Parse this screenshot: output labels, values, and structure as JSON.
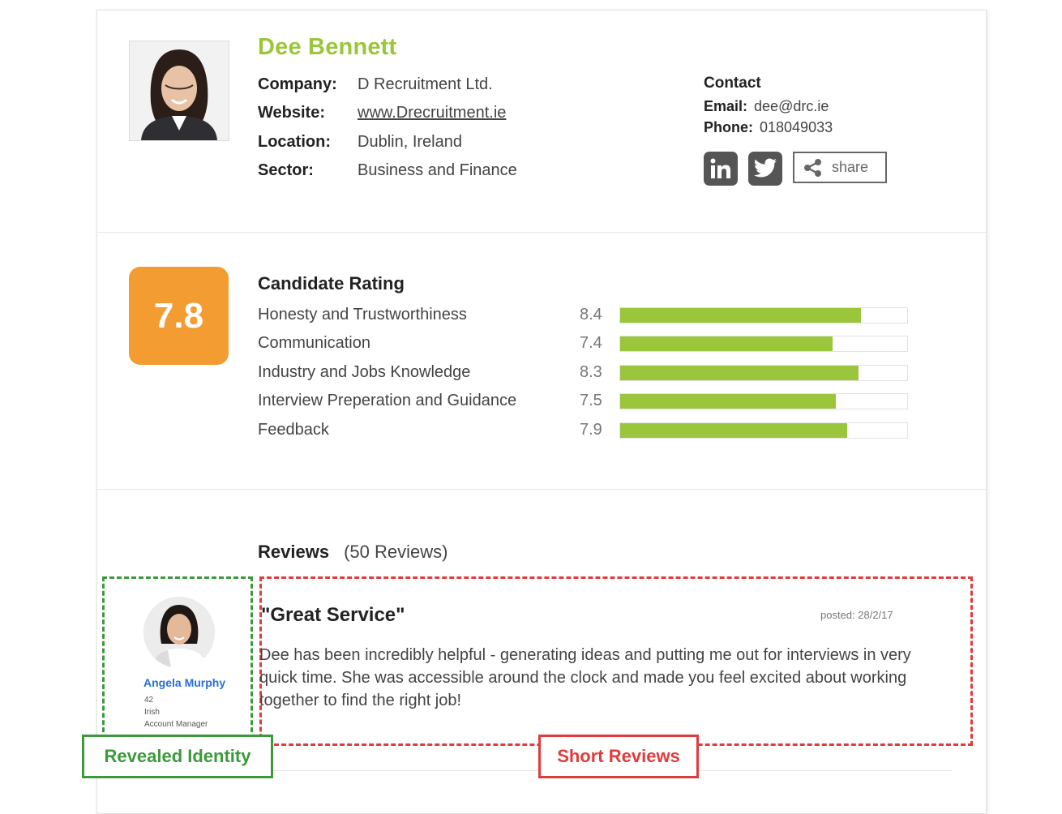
{
  "profile": {
    "name": "Dee Bennett",
    "fields": [
      {
        "label": "Company:",
        "value": "D Recruitment Ltd."
      },
      {
        "label": "Website:",
        "value": "www.Drecruitment.ie"
      },
      {
        "label": "Location:",
        "value": "Dublin, Ireland"
      },
      {
        "label": "Sector:",
        "value": "Business and Finance"
      }
    ]
  },
  "contact": {
    "title": "Contact",
    "email_label": "Email:",
    "email": "dee@drc.ie",
    "phone_label": "Phone:",
    "phone": "018049033",
    "share_label": "share"
  },
  "rating": {
    "overall": "7.8",
    "title": "Candidate Rating",
    "max": 10,
    "items": [
      {
        "label": "Honesty and Trustworthiness",
        "value": "8.4",
        "score": 8.4
      },
      {
        "label": "Communication",
        "value": "7.4",
        "score": 7.4
      },
      {
        "label": "Industry and Jobs Knowledge",
        "value": "8.3",
        "score": 8.3
      },
      {
        "label": "Interview Preperation and Guidance",
        "value": "7.5",
        "score": 7.5
      },
      {
        "label": "Feedback",
        "value": "7.9",
        "score": 7.9
      }
    ],
    "bar_color": "#9bc63b",
    "badge_color": "#f39c32"
  },
  "reviews": {
    "title": "Reviews",
    "count": "(50 Reviews)",
    "items": [
      {
        "reviewer_name": "Angela Murphy",
        "reviewer_age": "42",
        "reviewer_nationality": "Irish",
        "reviewer_role": "Account Manager",
        "title": "\"Great Service\"",
        "posted": "posted: 28/2/17",
        "body": "Dee has been incredibly helpful - generating ideas and putting me out for interviews in very quick time. She was accessible around the clock and made you feel excited about working together to find the right job!"
      }
    ]
  },
  "annotations": {
    "revealed_identity": "Revealed Identity",
    "short_reviews": "Short Reviews"
  }
}
